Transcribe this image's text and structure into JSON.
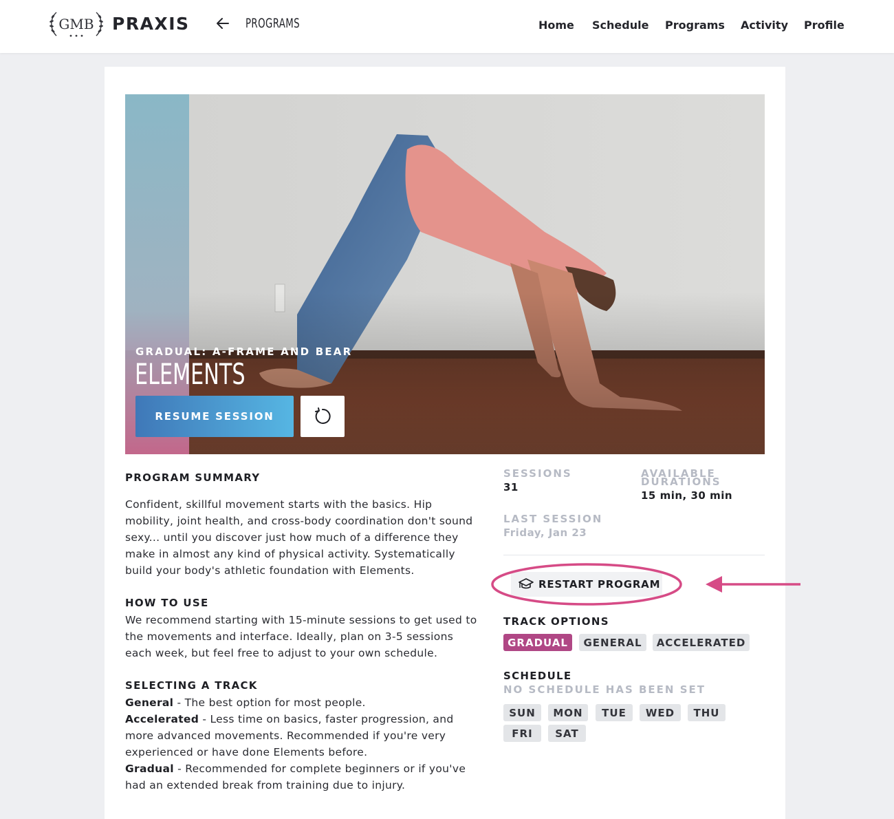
{
  "header": {
    "logo_text": "GMB",
    "brand": "PRAXIS",
    "breadcrumb": "PROGRAMS",
    "nav": [
      "Home",
      "Schedule",
      "Programs",
      "Activity",
      "Profile"
    ]
  },
  "hero": {
    "subtitle": "GRADUAL: A-FRAME AND BEAR",
    "title": "ELEMENTS",
    "resume_label": "RESUME SESSION"
  },
  "summary": {
    "heading": "PROGRAM SUMMARY",
    "text": "Confident, skillful movement starts with the basics. Hip mobility, joint health, and cross-body coordination don't sound sexy... until you discover just how much of a difference they make in almost any kind of physical activity. Systematically build your body's athletic foundation with Elements."
  },
  "how_to_use": {
    "heading": "HOW TO USE",
    "text": "We recommend starting with 15-minute sessions to get used to the movements and interface. Ideally, plan on 3-5 sessions each week, but feel free to adjust to your own schedule."
  },
  "selecting_track": {
    "heading": "SELECTING A TRACK",
    "items": [
      {
        "name": "General",
        "desc": " - The best option for most people."
      },
      {
        "name": "Accelerated",
        "desc": " - Less time on basics, faster progression, and more advanced movements. Recommended if you're very experienced or have done Elements before."
      },
      {
        "name": "Gradual",
        "desc": " - Recommended for complete beginners or if you've had an extended break from training due to injury."
      }
    ]
  },
  "stats": {
    "sessions_label": "SESSIONS",
    "sessions_value": "31",
    "durations_label_1": "AVAILABLE",
    "durations_label_2": "DURATIONS",
    "durations_value": "15 min, 30 min",
    "last_label": "LAST SESSION",
    "last_value": "Friday, Jan 23"
  },
  "restart_label": "RESTART PROGRAM",
  "track_options": {
    "heading": "TRACK OPTIONS",
    "options": [
      "GRADUAL",
      "GENERAL",
      "ACCELERATED"
    ],
    "selected": "GRADUAL"
  },
  "schedule": {
    "heading": "SCHEDULE",
    "status": "NO SCHEDULE HAS BEEN SET",
    "days": [
      "SUN",
      "MON",
      "TUE",
      "WED",
      "THU",
      "FRI",
      "SAT"
    ]
  },
  "colors": {
    "accent": "#b04785",
    "annotation": "#d64b86",
    "resume_start": "#3f78b8",
    "resume_end": "#56b6e3"
  }
}
